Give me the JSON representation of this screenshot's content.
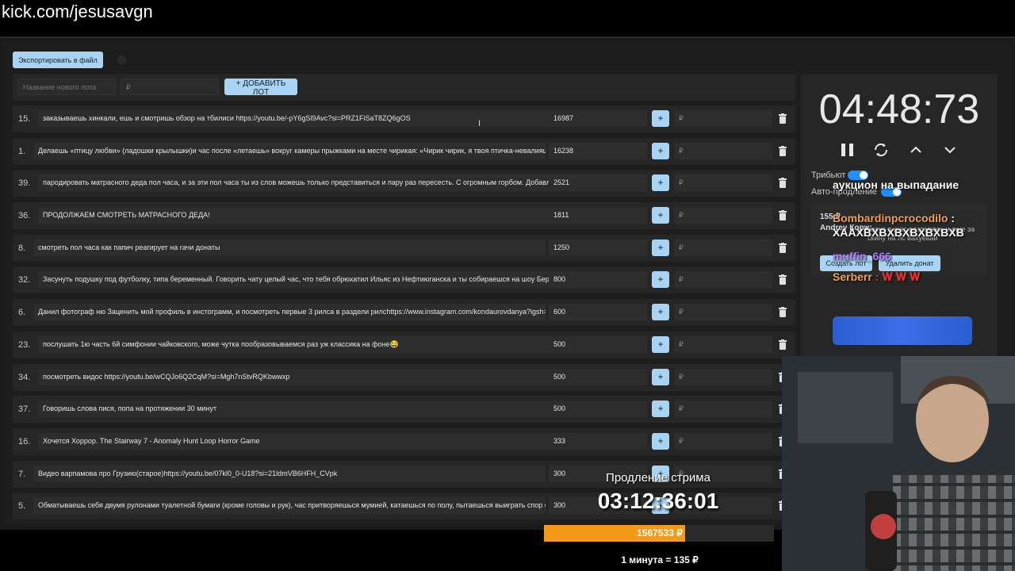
{
  "browser": {
    "url": "kick.com/jesusavgn"
  },
  "toolbar": {
    "export_label": "Экспортировать в файл"
  },
  "new_lot": {
    "name_placeholder": "Название нового лота",
    "amount_placeholder": "₽",
    "add_label": "+ ДОБАВИТЬ ЛОТ"
  },
  "lots": [
    {
      "num": "15.",
      "name": "заказываешь хинкали, ешь и смотришь обзор на тбилиси https://youtu.be/-pY6gSl9Avc?si=PRZ1FiSaT8ZQ6gOS",
      "amount": "16987",
      "plus": "+",
      "currency": "₽"
    },
    {
      "num": "1.",
      "name": "Делаешь «птицу любви» (ладошки крылышки)и час после «летаешь» вокруг камеры прыжками на месте чирикая: «Чирик чирик, я твоя птичка-невалияшка",
      "amount": "16238",
      "plus": "+",
      "currency": "₽"
    },
    {
      "num": "39.",
      "name": "пародировать матрасного деда пол часа, и за эти пол часа ты из слов можешь только представиться и пару раз пересесть. С огромным горбом. Добавл",
      "amount": "2521",
      "plus": "+",
      "currency": "₽"
    },
    {
      "num": "36.",
      "name": "ПРОДОЛЖАЕМ СМОТРЕТЬ МАТРАСНОГО ДЕДА!",
      "amount": "1811",
      "plus": "+",
      "currency": "₽"
    },
    {
      "num": "8.",
      "name": "смотреть пол часа как папич реагирует на гачи донаты",
      "amount": "1250",
      "plus": "+",
      "currency": "₽"
    },
    {
      "num": "32.",
      "name": "Засунуть подушку под футболку, типа беременный. Говорить чату целый час, что тебя обрюхатил Ильяс из Нефтиюганска и ты собираешся на шоу Бере",
      "amount": "800",
      "plus": "+",
      "currency": "₽"
    },
    {
      "num": "6.",
      "name": "Данил фотограф ню Заценить мой профиль в инстограмм, и посмотреть первые 3 рилса в раздели рилсhttps://www.instagram.com/kondaurovdanya?igsh=M",
      "amount": "600",
      "plus": "+",
      "currency": "₽"
    },
    {
      "num": "23.",
      "name": "послушать 1ю часть 6й симфонии чайковского, може чутка пообразовываемся раз уж классика на фоне😂",
      "amount": "500",
      "plus": "+",
      "currency": "₽"
    },
    {
      "num": "34.",
      "name": "посмотреть видос https://youtu.be/wCQJo6Q2CqM?si=Mgh7nStvRQKbwwxp",
      "amount": "500",
      "plus": "+",
      "currency": "₽"
    },
    {
      "num": "37.",
      "name": "Говоришь слова пися, попа на протяжении 30 минут",
      "amount": "500",
      "plus": "+",
      "currency": "₽"
    },
    {
      "num": "16.",
      "name": "Хочется Хоррор. The Stairway 7 - Anomaly Hunt Loop Horror Game",
      "amount": "333",
      "plus": "+",
      "currency": "₽"
    },
    {
      "num": "7.",
      "name": "Видео варпамова про Грузию(старое)https://youtu.be/07kl0_0-U18?si=21ldmVB6HFH_CVpk",
      "amount": "300",
      "plus": "+",
      "currency": "₽"
    },
    {
      "num": "5.",
      "name": "Обматываешь себя двумя рулонами туалетной бумаги (кроме головы и рук), час притворяешься мумией, катаешься по полу, пытаешься выиграть спор с",
      "amount": "300",
      "plus": "+",
      "currency": "₽"
    }
  ],
  "timer_panel": {
    "time": "04:48:73",
    "tribute_label": "Трибьют",
    "auto_label": "Авто-продление",
    "donate_header": "155 ₽",
    "donate_author": "Andrey Корж:",
    "donate_message": "хесус я щас разозлюсь и еще за скину на лс вахуевай",
    "create_lot_label": "Создать лот",
    "delete_donate_label": "Удалить донат"
  },
  "chat": [
    {
      "user": "",
      "text": "аукцион на выпадание",
      "color": "#ffffff"
    },
    {
      "user": "Bombardinpcrocodilo",
      "text": ": XAAXBXBXBXBXBXBXB",
      "color": "#f0a050"
    },
    {
      "user": "muffin_666",
      "text": "",
      "color": "#b57cff"
    },
    {
      "user": "Serberr",
      "text": ": 𝐖 𝐖 𝐖",
      "color": "#f0a050"
    }
  ],
  "stream_extend": {
    "label": "Продление стрима",
    "time": "03:12:36:01",
    "total": "1567533 ₽",
    "rate": "1 минута = 135 ₽"
  },
  "colors": {
    "accent": "#a9d3f3",
    "progress": "#f39a1a",
    "toggle": "#1e90ff"
  }
}
